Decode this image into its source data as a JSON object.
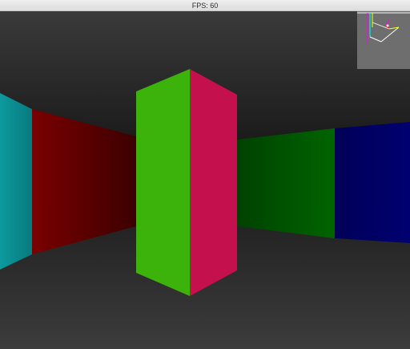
{
  "window": {
    "title": "FPS: 60"
  },
  "scene": {
    "ceiling_color": "#1f1f1f",
    "floor_color": "#2b2b2b",
    "walls": [
      {
        "name": "far-left-wall-cyan",
        "color": "#0a8a8e"
      },
      {
        "name": "left-wall-red",
        "color": "#7a0000"
      },
      {
        "name": "pillar-face-green",
        "color": "#3cb30b"
      },
      {
        "name": "pillar-face-crimson",
        "color": "#c4104c"
      },
      {
        "name": "right-wall-green",
        "color": "#005c00"
      },
      {
        "name": "right-wall-blue",
        "color": "#000066"
      }
    ]
  },
  "minimap": {
    "background": "#6e6e6e",
    "line_colors": [
      "#ffffff",
      "#ff00ff",
      "#00ffff",
      "#ffff00",
      "#ff0000"
    ]
  }
}
